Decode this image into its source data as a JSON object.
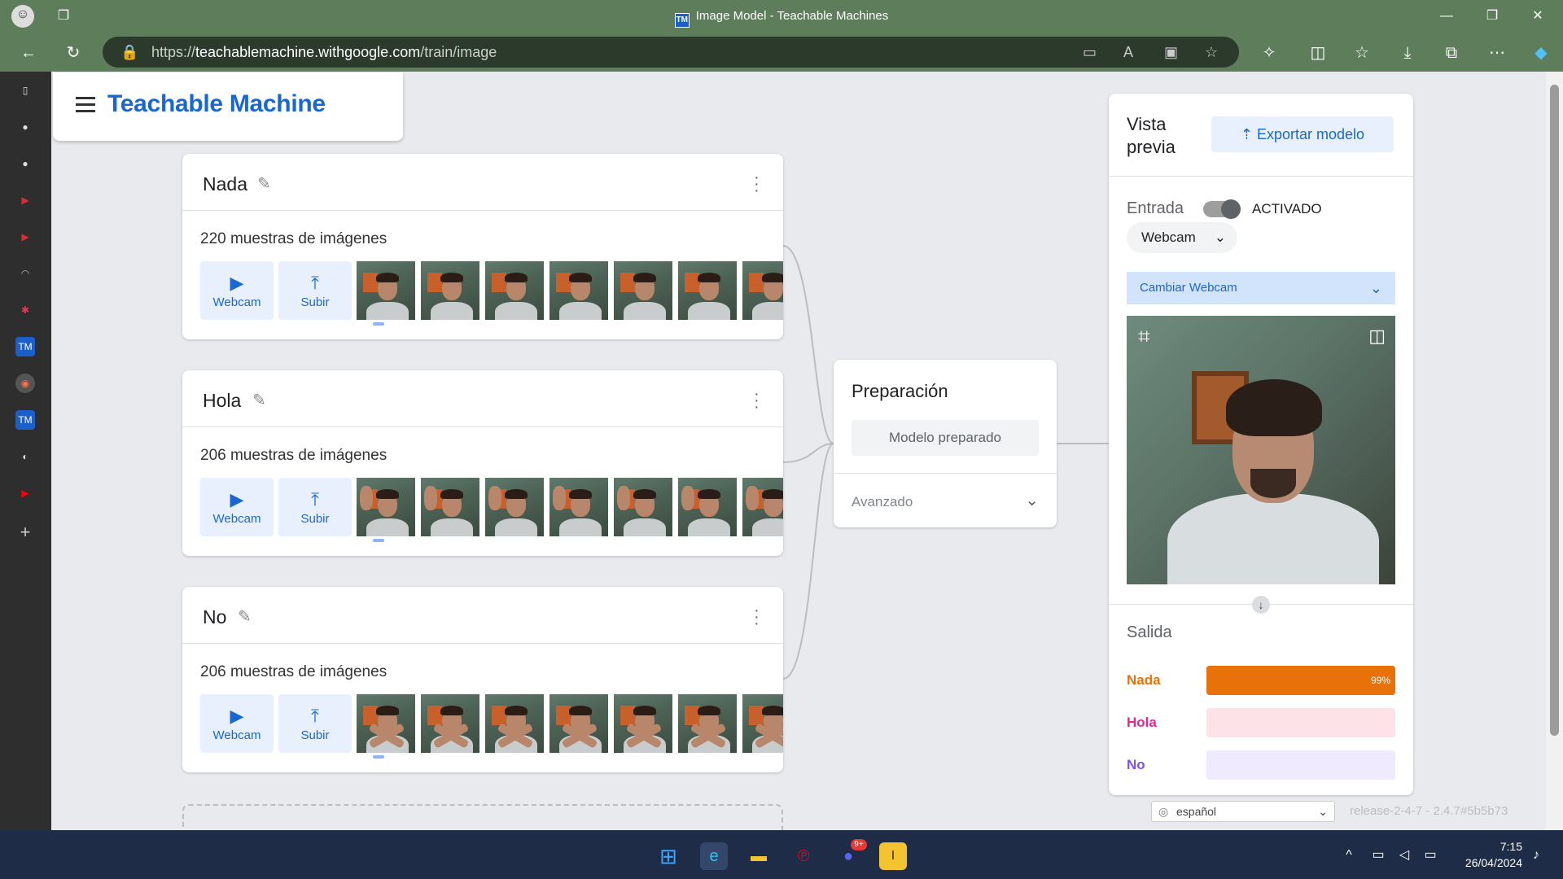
{
  "window": {
    "title": "Image Model - Teachable Machines",
    "app_badge": "TM"
  },
  "browser": {
    "url_scheme": "https://",
    "url_host": "teachablemachine.withgoogle.com",
    "url_path": "/train/image"
  },
  "app": {
    "logo": "Teachable Machine"
  },
  "classes": [
    {
      "name": "Nada",
      "samples": "220 muestras de imágenes",
      "webcam": "Webcam",
      "upload": "Subir",
      "pose": "neutral"
    },
    {
      "name": "Hola",
      "samples": "206 muestras de imágenes",
      "webcam": "Webcam",
      "upload": "Subir",
      "pose": "wave"
    },
    {
      "name": "No",
      "samples": "206 muestras de imágenes",
      "webcam": "Webcam",
      "upload": "Subir",
      "pose": "cross"
    }
  ],
  "training": {
    "title": "Preparación",
    "button": "Modelo preparado",
    "advanced": "Avanzado"
  },
  "preview": {
    "title": "Vista previa",
    "export": "Exportar modelo",
    "input_label": "Entrada",
    "toggle_state": "ACTIVADO",
    "source": "Webcam",
    "change_webcam": "Cambiar Webcam",
    "output_label": "Salida",
    "outputs": [
      {
        "name": "Nada",
        "percent": 99,
        "label": "99%",
        "color": "#e8710a",
        "track": "#e8710a"
      },
      {
        "name": "Hola",
        "percent": 0,
        "label": "",
        "color": "#e52592",
        "track": "#fde2e8"
      },
      {
        "name": "No",
        "percent": 0,
        "label": "",
        "color": "#7b52ee",
        "track": "#efeafd"
      }
    ]
  },
  "footer": {
    "language": "español",
    "release": "release-2-4-7 - 2.4.7#5b5b73"
  },
  "taskbar": {
    "time": "7:15",
    "date": "26/04/2024",
    "discord_badge": "9+"
  }
}
